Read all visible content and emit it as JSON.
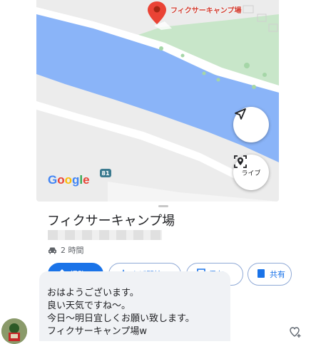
{
  "map": {
    "pin_label": "フィクサーキャンプ場",
    "google_logo": [
      "G",
      "o",
      "o",
      "g",
      "l",
      "e"
    ],
    "google_colors": [
      "#4285F4",
      "#EA4335",
      "#FBBC05",
      "#4285F4",
      "#34A853",
      "#EA4335"
    ],
    "route_number": "81",
    "live_button_label": "ライブ",
    "colors": {
      "water": "#8ab4f8",
      "park": "#c8e6c9",
      "road": "#ffffff",
      "land": "#ececec",
      "pin": "#ea4335"
    }
  },
  "place": {
    "title": "フィクサーキャンプ場",
    "drive_time": "2 時間",
    "action_chips": [
      "経路",
      "ナビ開始",
      "保存",
      "共有"
    ]
  },
  "message": {
    "lines": [
      "おはようございます。",
      "良い天気ですね～。",
      "今日～明日宜しくお願い致します。",
      "フィクサーキャンプ場w"
    ]
  }
}
